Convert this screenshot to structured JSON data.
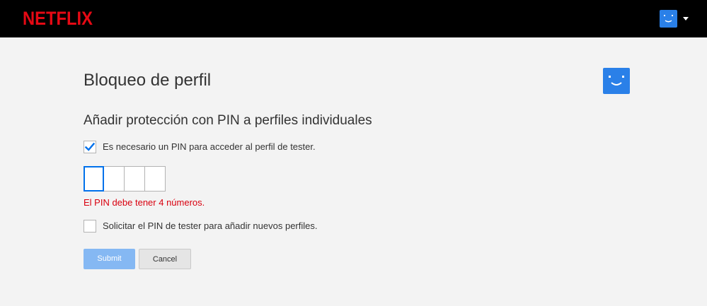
{
  "header": {
    "logo_text": "NETFLIX",
    "brand_color": "#e50914",
    "profile_icon": "smiley-face-icon",
    "menu_icon": "caret-down-icon"
  },
  "main": {
    "title": "Bloqueo de perfil",
    "profile_icon": "smiley-face-icon",
    "profile_color": "#2a80e8",
    "section_title": "Añadir protección con PIN a perfiles individuales",
    "require_pin": {
      "label": "Es necesario un PIN para acceder al perfil de tester.",
      "checked": true
    },
    "pin": {
      "digits": [
        "",
        "",
        "",
        ""
      ],
      "error": "El PIN debe tener 4 números.",
      "error_color": "#d9000f"
    },
    "require_pin_new_profiles": {
      "label": "Solicitar el PIN de tester para añadir nuevos perfiles.",
      "checked": false
    },
    "buttons": {
      "submit": "Submit",
      "cancel": "Cancel"
    }
  }
}
